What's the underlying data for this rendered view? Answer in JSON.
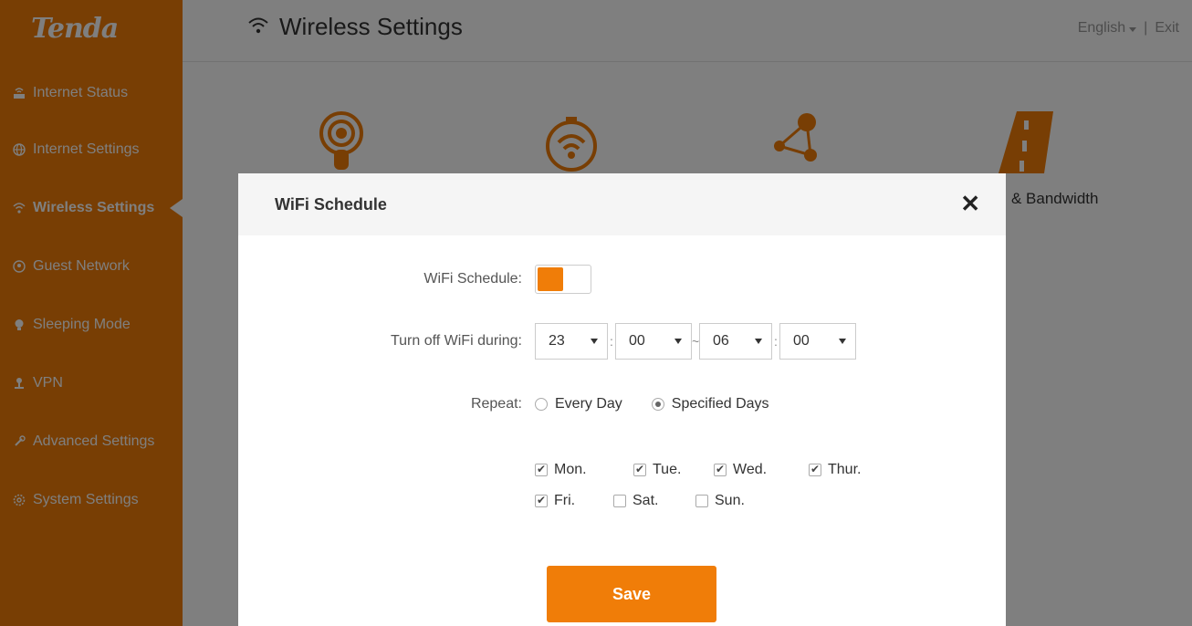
{
  "app": {
    "logo": "Tenda",
    "header_title": "Wireless Settings",
    "language": "English",
    "divider": "|",
    "exit": "Exit"
  },
  "sidebar": {
    "items": [
      {
        "label": "Internet Status",
        "icon": "router-icon"
      },
      {
        "label": "Internet Settings",
        "icon": "globe-icon"
      },
      {
        "label": "Wireless Settings",
        "icon": "wifi-icon",
        "active": true
      },
      {
        "label": "Guest Network",
        "icon": "guest-icon"
      },
      {
        "label": "Sleeping Mode",
        "icon": "bulb-icon"
      },
      {
        "label": "VPN",
        "icon": "vpn-icon"
      },
      {
        "label": "Advanced Settings",
        "icon": "wrench-icon"
      },
      {
        "label": "System Settings",
        "icon": "gear-icon"
      }
    ]
  },
  "tiles": {
    "partial_label": "& Bandwidth"
  },
  "modal": {
    "title": "WiFi Schedule",
    "close": "✕",
    "schedule_label": "WiFi Schedule:",
    "schedule_on": true,
    "turnoff_label": "Turn off WiFi during:",
    "start_hour": "23",
    "start_min": "00",
    "end_hour": "06",
    "end_min": "00",
    "colon": ":",
    "tilde": "~",
    "repeat_label": "Repeat:",
    "repeat_every_day": "Every Day",
    "repeat_specified": "Specified Days",
    "repeat_selected": "Specified Days",
    "days": {
      "mon": {
        "label": "Mon.",
        "checked": true
      },
      "tue": {
        "label": "Tue.",
        "checked": true
      },
      "wed": {
        "label": "Wed.",
        "checked": true
      },
      "thu": {
        "label": "Thur.",
        "checked": true
      },
      "fri": {
        "label": "Fri.",
        "checked": true
      },
      "sat": {
        "label": "Sat.",
        "checked": false
      },
      "sun": {
        "label": "Sun.",
        "checked": false
      }
    },
    "save": "Save"
  },
  "colors": {
    "brand": "#f07d08",
    "overlay": "rgba(0,0,0,0.5)"
  }
}
